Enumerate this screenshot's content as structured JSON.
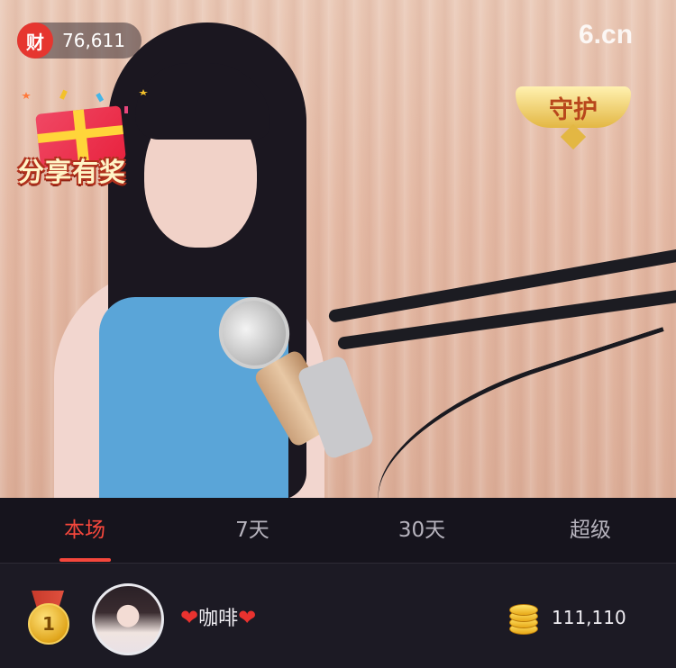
{
  "stream": {
    "wealth_badge_label": "财",
    "wealth_value": "76,611",
    "logo_text": "6.cn",
    "share_badge_text": "分享有奖",
    "guard_badge_text": "守护"
  },
  "tabs": [
    {
      "label": "本场",
      "active": true
    },
    {
      "label": "7天",
      "active": false
    },
    {
      "label": "30天",
      "active": false
    },
    {
      "label": "超级",
      "active": false
    }
  ],
  "ranking": [
    {
      "rank": "1",
      "name": "咖啡",
      "name_prefix_icon": "heart-icon",
      "name_suffix_icon": "heart-icon",
      "amount": "111,110",
      "amount_icon": "coin-stack-icon"
    }
  ],
  "colors": {
    "accent": "#f5473c",
    "background": "#16141d",
    "wealth_badge": "#e6362f"
  }
}
